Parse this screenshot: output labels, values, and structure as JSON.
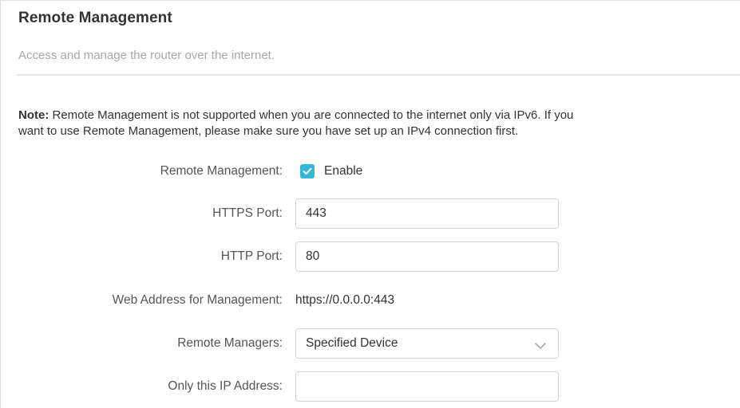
{
  "section": {
    "title": "Remote Management",
    "subtitle": "Access and manage the router over the internet."
  },
  "note": {
    "label": "Note:",
    "line1": " Remote Management is not supported when you are connected to the internet only via IPv6. If you",
    "line2": "want to use Remote Management, please make sure you have set up an IPv4 connection first."
  },
  "form": {
    "remote_management": {
      "label": "Remote Management:",
      "checkbox_label": "Enable",
      "checked": true
    },
    "https_port": {
      "label": "HTTPS Port:",
      "value": "443"
    },
    "http_port": {
      "label": "HTTP Port:",
      "value": "80"
    },
    "web_address": {
      "label": "Web Address for Management:",
      "value": "https://0.0.0.0:443"
    },
    "remote_managers": {
      "label": "Remote Managers:",
      "selected": "Specified Device"
    },
    "ip_address": {
      "label": "Only this IP Address:",
      "value": ""
    }
  },
  "colors": {
    "accent": "#35b8d8",
    "subtitle": "#a8a8a8",
    "border": "#d4d4d4"
  },
  "icons": {
    "checkbox": "checkmark-icon",
    "dropdown": "chevron-down-icon"
  }
}
